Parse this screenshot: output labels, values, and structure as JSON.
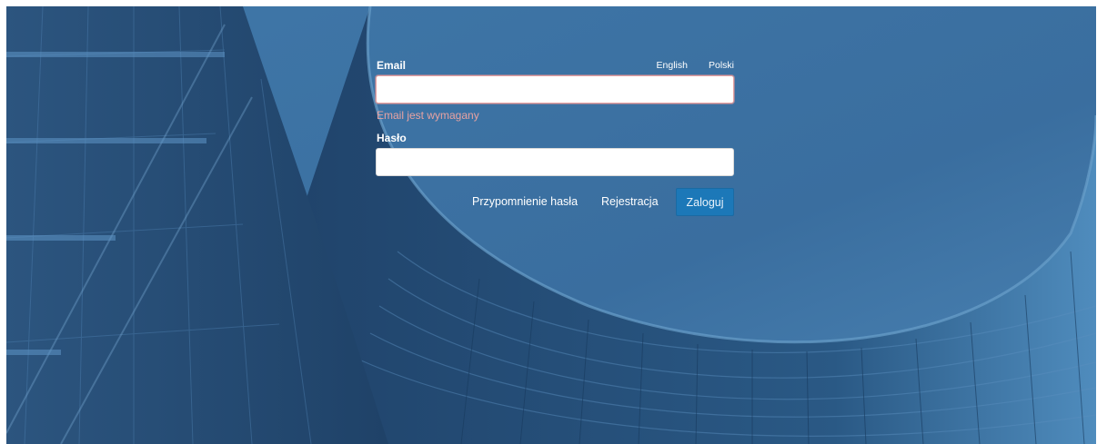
{
  "login": {
    "email_label": "Email",
    "email_value": "",
    "email_error": "Email jest wymagany",
    "password_label": "Hasło",
    "password_value": "",
    "languages": [
      "English",
      "Polski"
    ],
    "remind_password": "Przypomnienie hasła",
    "register": "Rejestracja",
    "submit": "Zaloguj"
  },
  "colors": {
    "background": "#244a72",
    "error": "#e7a2a2",
    "button": "#1c78b8",
    "label": "#ffffff"
  }
}
